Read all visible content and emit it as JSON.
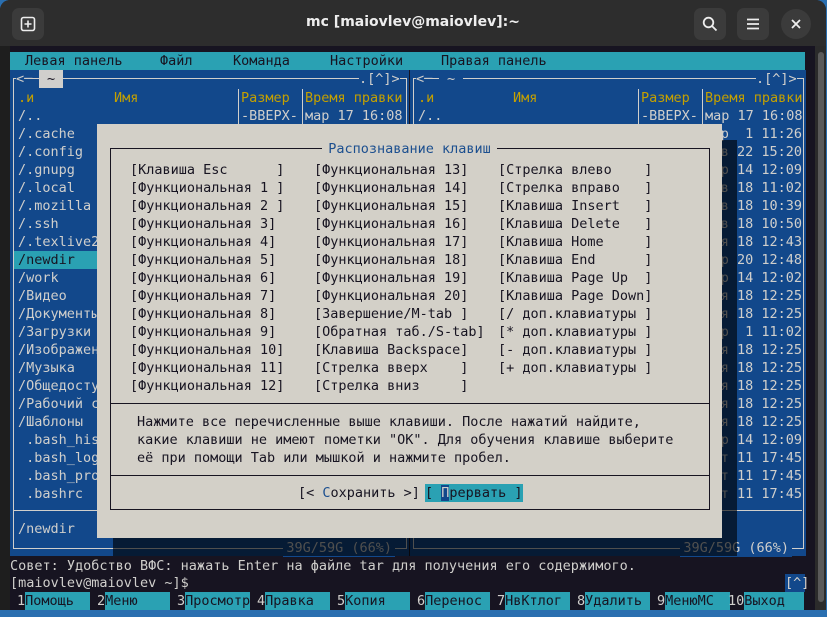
{
  "window": {
    "title": "mc [maiovlev@maiovlev]:~",
    "icons": [
      "new-tab-icon",
      "search-icon",
      "hamburger-menu-icon",
      "close-icon"
    ]
  },
  "menubar": [
    "Левая панель",
    "Файл",
    "Команда",
    "Настройки",
    "Правая панель"
  ],
  "left_panel": {
    "path": "~",
    "nav_left": "<─",
    "nav_right": ".[^]>",
    "headers": {
      "mark": ".и",
      "name": "Имя",
      "size": "Размер",
      "time": "Время правки"
    },
    "rows": [
      {
        "name": "/..",
        "size": "-ВВЕРХ-",
        "time": "мар 17 16:08"
      },
      {
        "name": "/.cache"
      },
      {
        "name": "/.config"
      },
      {
        "name": "/.gnupg"
      },
      {
        "name": "/.local"
      },
      {
        "name": "/.mozilla"
      },
      {
        "name": "/.ssh"
      },
      {
        "name": "/.texlive2"
      },
      {
        "name": "/newdir",
        "selected": true
      },
      {
        "name": "/work"
      },
      {
        "name": "/Видео"
      },
      {
        "name": "/Документы"
      },
      {
        "name": "/Загрузки"
      },
      {
        "name": "/Изображен"
      },
      {
        "name": "/Музыка"
      },
      {
        "name": "/Общедосту"
      },
      {
        "name": "/Рабочий с"
      },
      {
        "name": "/Шаблоны"
      },
      {
        "name": " .bash_his"
      },
      {
        "name": " .bash_log"
      },
      {
        "name": " .bash_pro"
      },
      {
        "name": " .bashrc"
      }
    ],
    "mini_status": "/newdir",
    "disk": "39G/59G (66%)"
  },
  "right_panel": {
    "path": "~",
    "nav_left": "<─",
    "nav_right": ".[^]>",
    "headers": {
      "mark": ".и",
      "name": "Имя",
      "size": "Размер",
      "time": "Время правки"
    },
    "rows": [
      {
        "name": "/..",
        "size": "-ВВЕРХ-",
        "time": "мар 17 16:08"
      },
      {
        "time": "р  1 11:26"
      },
      {
        "time": "в 22 15:20"
      },
      {
        "time": "р 14 12:09"
      },
      {
        "time": "в 18 11:02"
      },
      {
        "time": "в 18 10:39"
      },
      {
        "time": "в 18 10:50"
      },
      {
        "time": "я 18 12:43"
      },
      {
        "time": "р 20 12:48"
      },
      {
        "time": "р 14 12:02"
      },
      {
        "time": "я 18 12:25"
      },
      {
        "time": "я 18 12:25"
      },
      {
        "time": "р  1 11:02"
      },
      {
        "time": "я 18 12:25"
      },
      {
        "time": "я 18 12:25"
      },
      {
        "time": "я 18 12:25"
      },
      {
        "time": "я 18 12:25"
      },
      {
        "time": "я 18 12:25"
      },
      {
        "time": "р 14 12:09"
      },
      {
        "time": "т 11 17:45"
      },
      {
        "time": "т 11 17:45"
      },
      {
        "time": "т 11 17:45"
      }
    ],
    "disk": "39G/59G (66%)"
  },
  "dialog": {
    "title": "Распознавание клавиш",
    "columns": [
      [
        "[Клавиша Esc      ]",
        "[Функциональная 1 ]",
        "[Функциональная 2 ]",
        "[Функциональная 3]",
        "[Функциональная 4]",
        "[Функциональная 5]",
        "[Функциональная 6]",
        "[Функциональная 7]",
        "[Функциональная 8]",
        "[Функциональная 9]",
        "[Функциональная 10]",
        "[Функциональная 11]",
        "[Функциональная 12]"
      ],
      [
        "[Функциональная 13]",
        "[Функциональная 14]",
        "[Функциональная 15]",
        "[Функциональная 16]",
        "[Функциональная 17]",
        "[Функциональная 18]",
        "[Функциональная 19]",
        "[Функциональная 20]",
        "[Завершение/M-tab ]",
        "[Обратная таб./S-tab]",
        "[Клавиша Backspace]",
        "[Стрелка вверх    ]",
        "[Стрелка вниз     ]"
      ],
      [
        "[Стрелка влево    ]",
        "[Стрелка вправо   ]",
        "[Клавиша Insert   ]",
        "[Клавиша Delete   ]",
        "[Клавиша Home     ]",
        "[Клавиша End      ]",
        "[Клавиша Page Up  ]",
        "[Клавиша Page Down]",
        "[/ доп.клавиатуры ]",
        "[* доп.клавиатуры ]",
        "[- доп.клавиатуры ]",
        "[+ доп.клавиатуры ]"
      ]
    ],
    "help": [
      "Нажмите все перечисленные выше клавиши. После нажатий найдите,",
      "какие клавиши не имеют пометки \"OK\". Для обучения клавише выберите",
      "её при помощи Tab или мышкой и нажмите пробел."
    ],
    "save": {
      "pre": "[< ",
      "hot": "С",
      "rest": "охранить >]"
    },
    "abort": {
      "pre": "[ ",
      "hot": "П",
      "rest": "рервать ]"
    }
  },
  "hint": "Совет: Удобство ВФС: нажать Enter на файле tar для получения его содержимого.",
  "prompt": "[maiovlev@maiovlev ~]$",
  "prompt_scroll": "[^]",
  "fkeys": [
    {
      "n": "1",
      "label": "Помощь"
    },
    {
      "n": "2",
      "label": "Меню"
    },
    {
      "n": "3",
      "label": "Просмотр"
    },
    {
      "n": "4",
      "label": "Правка"
    },
    {
      "n": "5",
      "label": "Копия"
    },
    {
      "n": "6",
      "label": "Перенос"
    },
    {
      "n": "7",
      "label": "НвКтлог"
    },
    {
      "n": "8",
      "label": "Удалить"
    },
    {
      "n": "9",
      "label": "МенюМС"
    },
    {
      "n": "10",
      "label": "Выход"
    }
  ],
  "colors": {
    "panel": "#12488b",
    "accent": "#2aa1b3",
    "header": "#c4a000",
    "dialog": "#d3d0c8",
    "dialog_title": "#1c4f8f"
  }
}
